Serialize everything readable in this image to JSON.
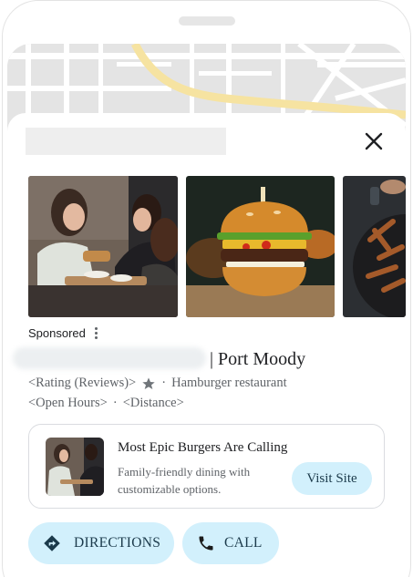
{
  "sheet": {
    "close_icon": "close-icon",
    "sponsored_label": "Sponsored",
    "menu_icon": "more-vert-icon"
  },
  "place": {
    "name_suffix": "| Port Moody",
    "rating_placeholder": "<Rating (Reviews)>",
    "rating_icon": "star-icon",
    "separator": "·",
    "category": "Hamburger restaurant",
    "hours_placeholder": "<Open Hours>",
    "distance_placeholder": "<Distance>"
  },
  "ad": {
    "title": "Most Epic Burgers Are Calling",
    "description": "Family-friendly dining with customizable options.",
    "cta": "Visit Site"
  },
  "actions": {
    "directions_label": "DIRECTIONS",
    "directions_icon": "directions-icon",
    "call_label": "CALL",
    "call_icon": "phone-icon"
  },
  "colors": {
    "button_bg": "#d2f0fc",
    "button_text": "#1b3a4b",
    "map_road": "#f6e3a1",
    "secondary_text": "#5f6368"
  }
}
